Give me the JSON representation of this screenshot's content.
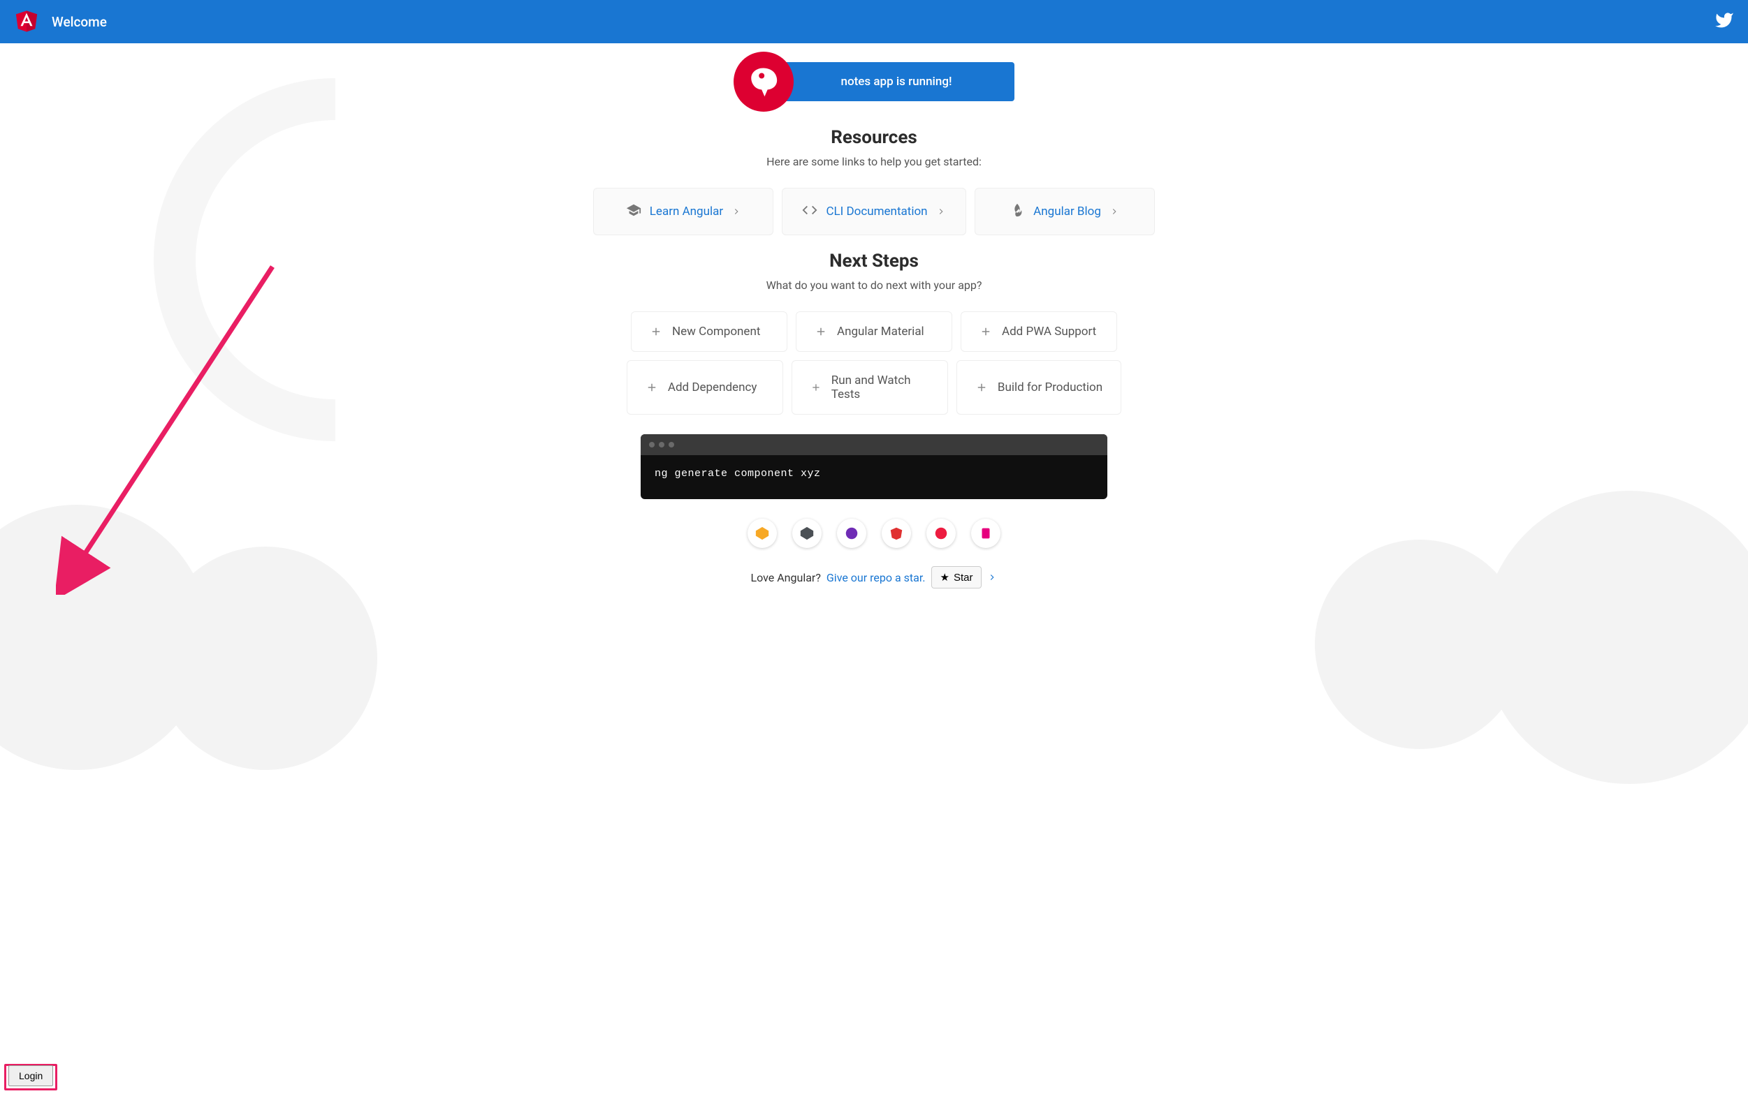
{
  "topbar": {
    "title": "Welcome"
  },
  "banner": {
    "text": "notes app is running!"
  },
  "resources": {
    "heading": "Resources",
    "subtitle": "Here are some links to help you get started:",
    "cards": [
      {
        "label": "Learn Angular"
      },
      {
        "label": "CLI Documentation"
      },
      {
        "label": "Angular Blog"
      }
    ]
  },
  "next_steps": {
    "heading": "Next Steps",
    "subtitle": "What do you want to do next with your app?",
    "items": [
      "New Component",
      "Angular Material",
      "Add PWA Support",
      "Add Dependency",
      "Run and Watch Tests",
      "Build for Production"
    ]
  },
  "terminal": {
    "command": "ng generate component xyz"
  },
  "link_icons": [
    "animations",
    "cli",
    "augury",
    "protractor",
    "meetup",
    "gitter"
  ],
  "love": {
    "prefix": "Love Angular?",
    "link": "Give our repo a star.",
    "button": "Star"
  },
  "login": {
    "label": "Login"
  },
  "colors": {
    "primary": "#1976d2",
    "accent_red": "#dd0031",
    "accent_pink": "#e91e63"
  }
}
